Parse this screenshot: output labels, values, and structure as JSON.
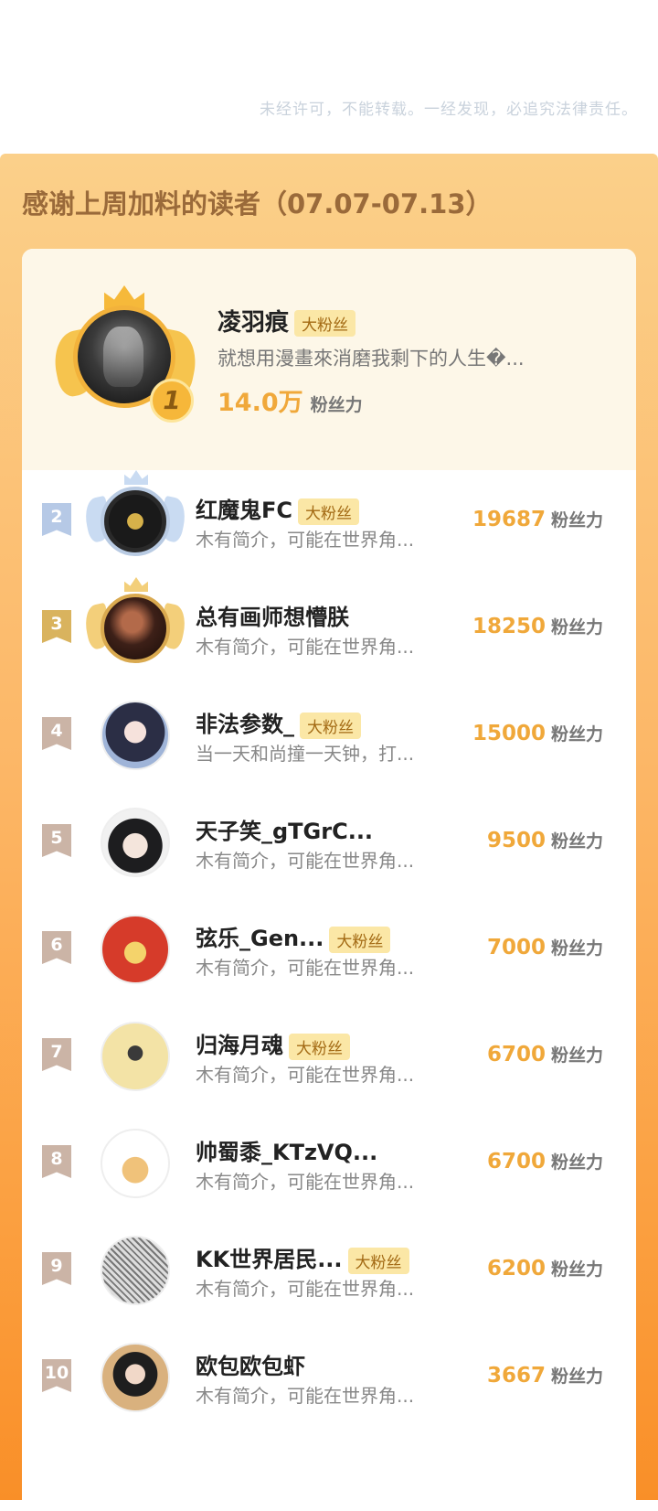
{
  "notice": "未经许可，不能转载。一经发现，必追究法律责任。",
  "panel_title": "感谢上周加料的读者（07.07-07.13）",
  "colors": {
    "accent": "#f0a83a",
    "badge_bg": "#fbe7a6",
    "rank2": "#b6c9e6",
    "rank3": "#d9b35e",
    "rank_other": "#cbb4a6"
  },
  "top1": {
    "rank": "1",
    "name": "凌羽痕",
    "tag": "大粉丝",
    "bio": "就想用漫畫來消磨我剩下的人生�...",
    "score": "14.0万",
    "unit": "粉丝力"
  },
  "rows": [
    {
      "rank": "2",
      "name": "红魔鬼FC",
      "tag": "大粉丝",
      "bio": "木有简介，可能在世界角...",
      "score": "19687",
      "unit": "粉丝力",
      "avatar": "manchester-united-crest"
    },
    {
      "rank": "3",
      "name": "总有画师想懵朕",
      "tag": "",
      "bio": "木有简介，可能在世界角...",
      "score": "18250",
      "unit": "粉丝力",
      "avatar": "dark-portrait"
    },
    {
      "rank": "4",
      "name": "非法参数_",
      "tag": "大粉丝",
      "bio": "当一天和尚撞一天钟，打...",
      "score": "15000",
      "unit": "粉丝力",
      "avatar": "anime-girl"
    },
    {
      "rank": "5",
      "name": "天子笑_gTGrC...",
      "tag": "",
      "bio": "木有简介，可能在世界角...",
      "score": "9500",
      "unit": "粉丝力",
      "avatar": "anime-boy"
    },
    {
      "rank": "6",
      "name": "弦乐_Gen...",
      "tag": "大粉丝",
      "bio": "木有简介，可能在世界角...",
      "score": "7000",
      "unit": "粉丝力",
      "avatar": "red-cartoon"
    },
    {
      "rank": "7",
      "name": "归海月魂",
      "tag": "大粉丝",
      "bio": "木有简介，可能在世界角...",
      "score": "6700",
      "unit": "粉丝力",
      "avatar": "ink-figure"
    },
    {
      "rank": "8",
      "name": "帅蜀黍_KTzVQ...",
      "tag": "",
      "bio": "木有简介，可能在世界角...",
      "score": "6700",
      "unit": "粉丝力",
      "avatar": "tiger-cartoon"
    },
    {
      "rank": "9",
      "name": "KK世界居民...",
      "tag": "大粉丝",
      "bio": "木有简介，可能在世界角...",
      "score": "6200",
      "unit": "粉丝力",
      "avatar": "manga-sketch"
    },
    {
      "rank": "10",
      "name": "欧包欧包虾",
      "tag": "",
      "bio": "木有简介，可能在世界角...",
      "score": "3667",
      "unit": "粉丝力",
      "avatar": "girl-photo"
    }
  ]
}
